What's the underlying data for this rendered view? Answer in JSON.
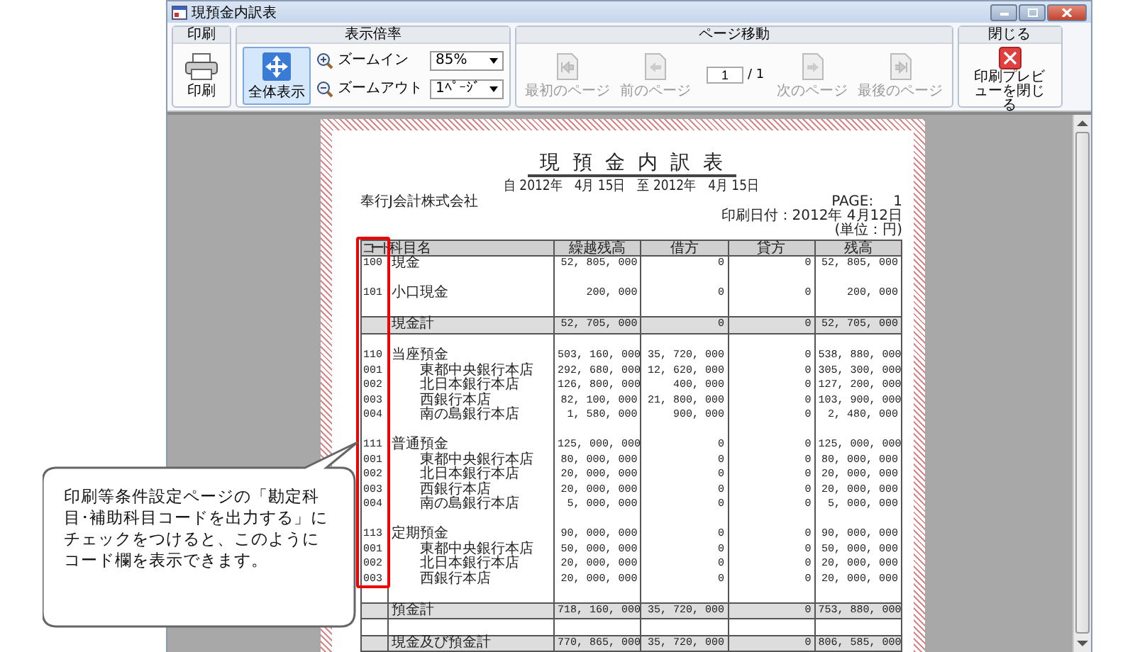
{
  "window": {
    "title": "現預金内訳表"
  },
  "print_group": {
    "title": "印刷",
    "button": "印刷"
  },
  "zoom_group": {
    "title": "表示倍率",
    "fit_button": {
      "label": "全体表示",
      "selected": true
    },
    "zoom_in": "ズームイン",
    "zoom_out": "ズームアウト",
    "zoom_value": "85%",
    "page_mode": "1ﾍﾟｰｼﾞ"
  },
  "page_nav_group": {
    "title": "ページ移動",
    "buttons": [
      {
        "kind": "first",
        "label": "最初のページ",
        "disabled": true
      },
      {
        "kind": "prev",
        "label": "前のページ",
        "disabled": true
      },
      {
        "kind": "next",
        "label": "次のページ",
        "disabled": true
      },
      {
        "kind": "last",
        "label": "最後のページ",
        "disabled": true
      }
    ],
    "page_input": "1",
    "page_total": "/ 1"
  },
  "close_group": {
    "title": "閉じる",
    "button": "印刷プレビューを閉じる"
  },
  "report": {
    "title": "現預金内訳表",
    "period": "自 2012年　4月 15日　至 2012年　4月 15日",
    "company": "奉行J会計株式会社",
    "page_label": "PAGE:",
    "page_number": "1",
    "print_date": "印刷日付：2012年 4月12日",
    "unit": "(単位：円)",
    "columns": [
      "コード",
      "科目名",
      "繰越残高",
      "借方",
      "貸方",
      "残高"
    ],
    "rows": [
      {
        "kind": "account",
        "code": "100",
        "name": "現金",
        "values": [
          "52, 805, 000",
          "0",
          "0",
          "52, 805, 000"
        ]
      },
      {
        "kind": "blank"
      },
      {
        "kind": "account",
        "code": "101",
        "name": "小口現金",
        "values": [
          "200, 000",
          "0",
          "0",
          "200, 000"
        ]
      },
      {
        "kind": "blank"
      },
      {
        "kind": "total",
        "name": "現金計",
        "values": [
          "52, 705, 000",
          "0",
          "0",
          "52, 705, 000"
        ]
      },
      {
        "kind": "blank"
      },
      {
        "kind": "account",
        "code": "110",
        "name": "当座預金",
        "values": [
          "503, 160, 000",
          "35, 720, 000",
          "0",
          "538, 880, 000"
        ]
      },
      {
        "kind": "sub",
        "code": "001",
        "name": "東都中央銀行本店",
        "values": [
          "292, 680, 000",
          "12, 620, 000",
          "0",
          "305, 300, 000"
        ]
      },
      {
        "kind": "sub",
        "code": "002",
        "name": "北日本銀行本店",
        "values": [
          "126, 800, 000",
          "400, 000",
          "0",
          "127, 200, 000"
        ]
      },
      {
        "kind": "sub",
        "code": "003",
        "name": "西銀行本店",
        "values": [
          "82, 100, 000",
          "21, 800, 000",
          "0",
          "103, 900, 000"
        ]
      },
      {
        "kind": "sub",
        "code": "004",
        "name": "南の島銀行本店",
        "values": [
          "1, 580, 000",
          "900, 000",
          "0",
          "2, 480, 000"
        ]
      },
      {
        "kind": "blank"
      },
      {
        "kind": "account",
        "code": "111",
        "name": "普通預金",
        "values": [
          "125, 000, 000",
          "0",
          "0",
          "125, 000, 000"
        ]
      },
      {
        "kind": "sub",
        "code": "001",
        "name": "東都中央銀行本店",
        "values": [
          "80, 000, 000",
          "0",
          "0",
          "80, 000, 000"
        ]
      },
      {
        "kind": "sub",
        "code": "002",
        "name": "北日本銀行本店",
        "values": [
          "20, 000, 000",
          "0",
          "0",
          "20, 000, 000"
        ]
      },
      {
        "kind": "sub",
        "code": "003",
        "name": "西銀行本店",
        "values": [
          "20, 000, 000",
          "0",
          "0",
          "20, 000, 000"
        ]
      },
      {
        "kind": "sub",
        "code": "004",
        "name": "南の島銀行本店",
        "values": [
          "5, 000, 000",
          "0",
          "0",
          "5, 000, 000"
        ]
      },
      {
        "kind": "blank"
      },
      {
        "kind": "account",
        "code": "113",
        "name": "定期預金",
        "values": [
          "90, 000, 000",
          "0",
          "0",
          "90, 000, 000"
        ]
      },
      {
        "kind": "sub",
        "code": "001",
        "name": "東都中央銀行本店",
        "values": [
          "50, 000, 000",
          "0",
          "0",
          "50, 000, 000"
        ]
      },
      {
        "kind": "sub",
        "code": "002",
        "name": "北日本銀行本店",
        "values": [
          "20, 000, 000",
          "0",
          "0",
          "20, 000, 000"
        ]
      },
      {
        "kind": "sub",
        "code": "003",
        "name": "西銀行本店",
        "values": [
          "20, 000, 000",
          "0",
          "0",
          "20, 000, 000"
        ]
      },
      {
        "kind": "blank"
      },
      {
        "kind": "total",
        "name": "預金計",
        "values": [
          "718, 160, 000",
          "35, 720, 000",
          "0",
          "753, 880, 000"
        ]
      },
      {
        "kind": "blank"
      },
      {
        "kind": "total",
        "name": "現金及び預金計",
        "values": [
          "770, 865, 000",
          "35, 720, 000",
          "0",
          "806, 585, 000"
        ]
      }
    ]
  },
  "callout": {
    "text": "印刷等条件設定ページの「勘定科目･補助科目コードを出力する」にチェックをつけると、このようにコード欄を表示できます。"
  }
}
